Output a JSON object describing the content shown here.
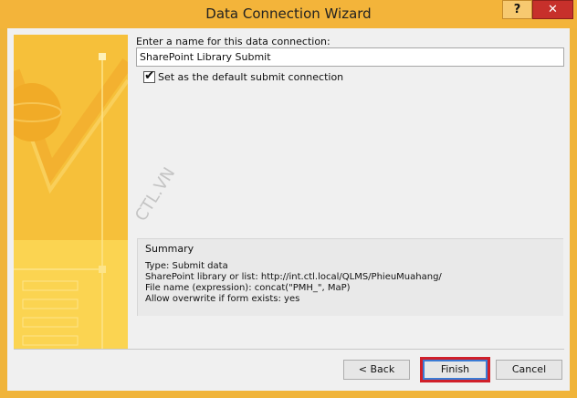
{
  "window": {
    "title": "Data Connection Wizard",
    "help_label": "?",
    "close_label": "✕"
  },
  "form": {
    "name_label": "Enter a name for this data connection:",
    "name_value": "SharePoint Library Submit",
    "default_checkbox_checked": true,
    "default_checkbox_label": "Set as the default submit connection"
  },
  "summary": {
    "title": "Summary",
    "lines": [
      "Type: Submit data",
      "SharePoint library or list: http://int.ctl.local/QLMS/PhieuMuahang/",
      "File name (expression): concat(\"PMH_\", MaP)",
      "Allow overwrite if form exists: yes"
    ]
  },
  "watermark": "CTL.VN",
  "buttons": {
    "back_label": "< Back",
    "finish_label": "Finish",
    "cancel_label": "Cancel"
  },
  "colors": {
    "title_bar": "#f3b43a",
    "banner": "#f8c73a",
    "close_button": "#c7302b",
    "highlight_box": "#d0202a"
  }
}
